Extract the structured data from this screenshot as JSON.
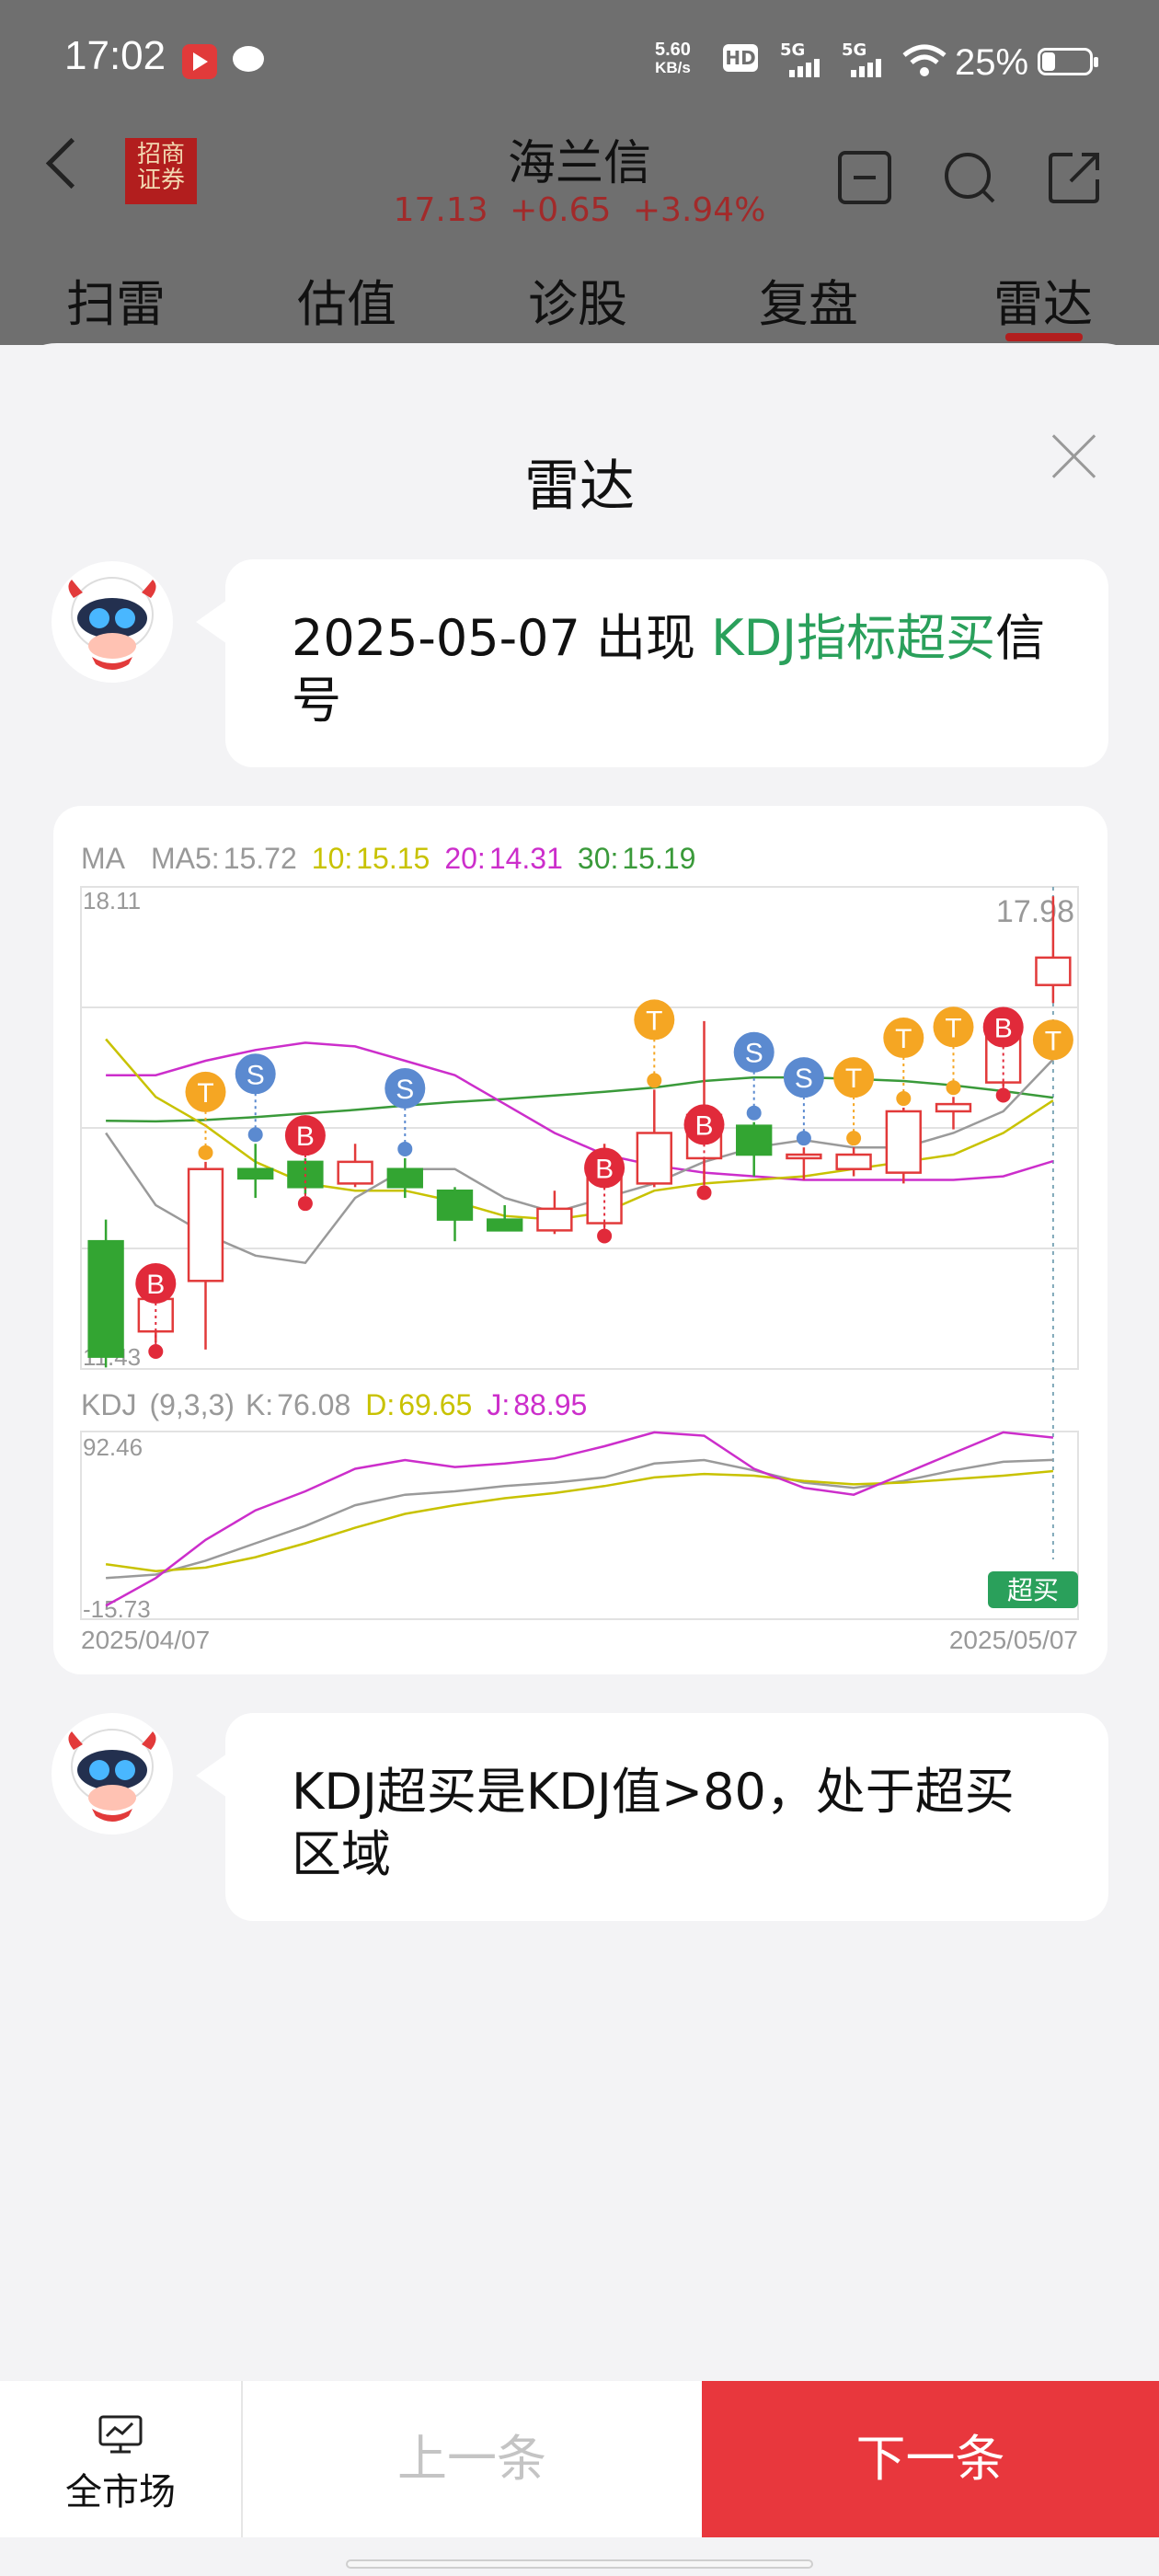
{
  "status_bar": {
    "time": "17:02",
    "net_speed_value": "5.60",
    "net_speed_unit": "KB/s",
    "hd_label": "HD",
    "signal1_label": "5G",
    "signal2_label": "5G",
    "battery": "25%",
    "battery_level": 0.25
  },
  "header": {
    "broker_logo_line1": "招商",
    "broker_logo_line2": "证券",
    "stock_name": "海兰信",
    "price": "17.13",
    "change": "+0.65",
    "change_pct": "+3.94%",
    "icons": [
      "back-icon",
      "minus-box-icon",
      "search-icon",
      "share-icon"
    ]
  },
  "tabs": [
    {
      "label": "扫雷",
      "active": false
    },
    {
      "label": "估值",
      "active": false
    },
    {
      "label": "诊股",
      "active": false
    },
    {
      "label": "复盘",
      "active": false
    },
    {
      "label": "雷达",
      "active": true
    }
  ],
  "sheet": {
    "title": "雷达",
    "message1": {
      "prefix": "2025-05-07  出现 ",
      "highlight": "KDJ指标超买",
      "suffix": "信号"
    },
    "message2": {
      "text": "KDJ超买是KDJ值>80，处于超买区域"
    }
  },
  "colors": {
    "up": "#e23a3a",
    "down": "#33a532",
    "ma5": "#9a9a9a",
    "ma10": "#c8c200",
    "ma20": "#cc2ecb",
    "ma30": "#3a9a3a",
    "signal_B": "#e12a3a",
    "signal_S": "#5b8ad0",
    "signal_T": "#f5a623",
    "highlight": "#2aa05b",
    "next_button": "#e8373d"
  },
  "chart_data": [
    {
      "type": "candlestick",
      "legend": {
        "title": "MA",
        "ma5_label": "MA5:",
        "ma5_value": "15.72",
        "ma10_label": "10:",
        "ma10_value": "15.15",
        "ma20_label": "20:",
        "ma20_value": "14.31",
        "ma30_label": "30:",
        "ma30_value": "15.19"
      },
      "y_max_label": "18.11",
      "y_min_label": "11.43",
      "high_label": "17.98",
      "ylim": [
        11.43,
        18.11
      ],
      "candles": [
        {
          "open": 13.2,
          "close": 11.6,
          "high": 13.5,
          "low": 11.45
        },
        {
          "open": 11.95,
          "close": 12.4,
          "high": 12.6,
          "low": 11.8
        },
        {
          "open": 12.65,
          "close": 14.2,
          "high": 14.3,
          "low": 11.7
        },
        {
          "open": 14.2,
          "close": 14.07,
          "high": 14.55,
          "low": 13.8
        },
        {
          "open": 14.3,
          "close": 13.95,
          "high": 14.35,
          "low": 13.85
        },
        {
          "open": 14.0,
          "close": 14.3,
          "high": 14.55,
          "low": 13.95
        },
        {
          "open": 14.2,
          "close": 13.95,
          "high": 14.35,
          "low": 13.8
        },
        {
          "open": 13.9,
          "close": 13.5,
          "high": 13.95,
          "low": 13.2
        },
        {
          "open": 13.5,
          "close": 13.35,
          "high": 13.7,
          "low": 13.35
        },
        {
          "open": 13.35,
          "close": 13.65,
          "high": 13.9,
          "low": 13.3
        },
        {
          "open": 13.45,
          "close": 14.2,
          "high": 14.55,
          "low": 13.4
        },
        {
          "open": 14.0,
          "close": 14.7,
          "high": 15.3,
          "low": 13.95
        },
        {
          "open": 14.35,
          "close": 14.95,
          "high": 16.25,
          "low": 14.0
        },
        {
          "open": 14.8,
          "close": 14.4,
          "high": 14.85,
          "low": 14.1
        },
        {
          "open": 14.35,
          "close": 14.4,
          "high": 14.5,
          "low": 14.05
        },
        {
          "open": 14.2,
          "close": 14.4,
          "high": 14.5,
          "low": 14.1
        },
        {
          "open": 14.15,
          "close": 15.0,
          "high": 15.05,
          "low": 14.0
        },
        {
          "open": 15.0,
          "close": 15.1,
          "high": 15.2,
          "low": 14.75
        },
        {
          "open": 15.4,
          "close": 16.15,
          "high": 16.4,
          "low": 15.35
        },
        {
          "open": 16.75,
          "close": 17.13,
          "high": 17.98,
          "low": 16.5
        }
      ],
      "ma5": [
        14.7,
        13.7,
        13.3,
        13.0,
        12.9,
        13.8,
        14.2,
        14.2,
        13.8,
        13.6,
        13.8,
        14.0,
        14.3,
        14.5,
        14.6,
        14.5,
        14.5,
        14.7,
        15.0,
        15.72
      ],
      "ma10": [
        16.0,
        15.2,
        14.8,
        14.3,
        14.0,
        13.9,
        13.9,
        13.75,
        13.55,
        13.5,
        13.6,
        13.9,
        14.0,
        14.05,
        14.1,
        14.2,
        14.3,
        14.4,
        14.7,
        15.15
      ],
      "ma20": [
        15.5,
        15.5,
        15.7,
        15.85,
        15.95,
        15.9,
        15.7,
        15.5,
        15.1,
        14.7,
        14.4,
        14.25,
        14.15,
        14.1,
        14.05,
        14.05,
        14.05,
        14.05,
        14.1,
        14.31
      ],
      "ma30": [
        14.87,
        14.86,
        14.88,
        14.92,
        14.97,
        15.02,
        15.08,
        15.13,
        15.17,
        15.22,
        15.27,
        15.33,
        15.42,
        15.47,
        15.47,
        15.45,
        15.42,
        15.36,
        15.28,
        15.19
      ],
      "signals": [
        {
          "index": 1,
          "type": "B"
        },
        {
          "index": 2,
          "type": "T"
        },
        {
          "index": 3,
          "type": "S"
        },
        {
          "index": 4,
          "type": "B"
        },
        {
          "index": 6,
          "type": "S"
        },
        {
          "index": 10,
          "type": "B"
        },
        {
          "index": 11,
          "type": "T"
        },
        {
          "index": 12,
          "type": "B"
        },
        {
          "index": 13,
          "type": "S"
        },
        {
          "index": 14,
          "type": "S"
        },
        {
          "index": 15,
          "type": "T"
        },
        {
          "index": 16,
          "type": "T"
        },
        {
          "index": 17,
          "type": "T"
        },
        {
          "index": 18,
          "type": "B"
        },
        {
          "index": 19,
          "type": "T"
        }
      ]
    },
    {
      "type": "line",
      "legend": {
        "title": "KDJ",
        "params": "(9,3,3)",
        "k_label": "K:",
        "k_value": "76.08",
        "d_label": "D:",
        "d_value": "69.65",
        "j_label": "J:",
        "j_value": "88.95"
      },
      "y_max_label": "92.46",
      "y_min_label": "-15.73",
      "ylim": [
        -15.73,
        92.46
      ],
      "x_start_label": "2025/04/07",
      "x_end_label": "2025/05/07",
      "badge": "超买",
      "series": [
        {
          "key": "K",
          "color": "#9a9a9a",
          "values": [
            8,
            10,
            18,
            28,
            38,
            50,
            56,
            58,
            61,
            63,
            66,
            74,
            76,
            70,
            63,
            60,
            64,
            70,
            75,
            76.08
          ]
        },
        {
          "key": "D",
          "color": "#c8c200",
          "values": [
            16,
            12,
            14,
            20,
            28,
            37,
            45,
            50,
            54,
            57,
            61,
            66,
            68,
            67,
            64,
            62,
            63,
            65,
            67,
            69.65
          ]
        },
        {
          "key": "J",
          "color": "#cc2ecb",
          "values": [
            -8,
            8,
            30,
            47,
            58,
            71,
            76,
            72,
            74,
            77,
            84,
            92,
            90,
            71,
            60,
            56,
            68,
            80,
            92,
            88.95
          ]
        }
      ]
    }
  ],
  "bottom_bar": {
    "market_label": "全市场",
    "prev_label": "上一条",
    "next_label": "下一条"
  }
}
